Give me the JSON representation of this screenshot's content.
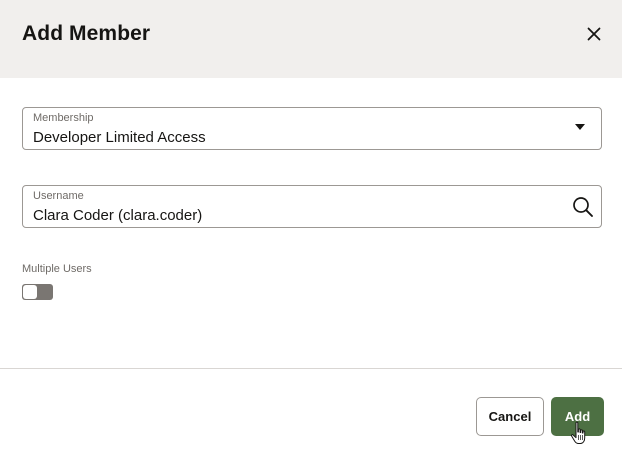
{
  "dialog": {
    "title": "Add Member",
    "close_icon": "close-icon"
  },
  "membership": {
    "label": "Membership",
    "value": "Developer Limited Access",
    "icon": "chevron-down-icon"
  },
  "username": {
    "label": "Username",
    "value": "Clara Coder (clara.coder)",
    "icon": "search-icon"
  },
  "multiple_users": {
    "label": "Multiple Users",
    "enabled": false
  },
  "footer": {
    "cancel_label": "Cancel",
    "add_label": "Add"
  },
  "colors": {
    "header_bg": "#f1efed",
    "primary_button": "#4d7043",
    "toggle_off": "#7a7672"
  }
}
